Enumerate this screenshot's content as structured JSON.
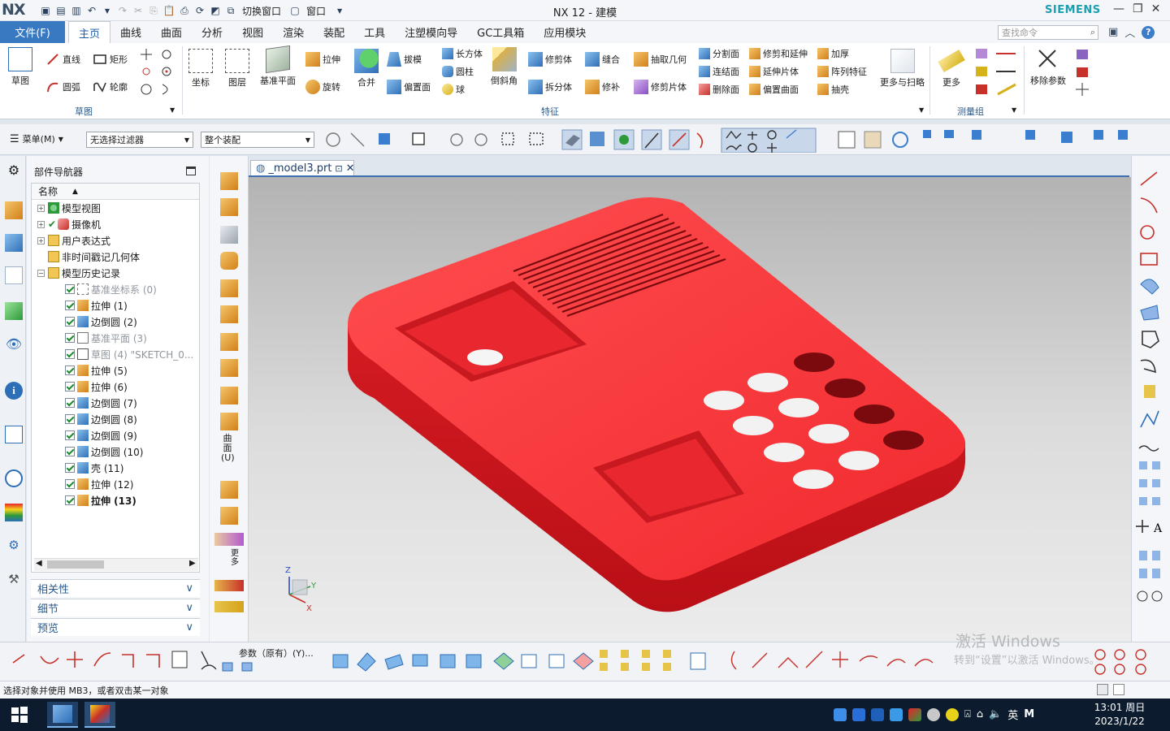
{
  "app": {
    "logo": "NX",
    "title": "NX 12 - 建模",
    "brand": "SIEMENS"
  },
  "qat": {
    "switch_window": "切换窗口",
    "window": "窗口"
  },
  "tabs": {
    "file": "文件(F)",
    "items": [
      "主页",
      "曲线",
      "曲面",
      "分析",
      "视图",
      "渲染",
      "装配",
      "工具",
      "注塑模向导",
      "GC工具箱",
      "应用模块"
    ]
  },
  "search": {
    "placeholder": "查找命令"
  },
  "ribbon": {
    "sketch": "草图",
    "line": "直线",
    "rect": "矩形",
    "arc": "圆弧",
    "profile": "轮廓",
    "coord": "坐标",
    "layer": "图层",
    "datum": "基准平面",
    "extrude": "拉伸",
    "revolve": "旋转",
    "unite": "合并",
    "draft": "拔模",
    "offset_face": "偏置面",
    "block": "长方体",
    "cylinder": "圆柱",
    "sphere": "球",
    "chamfer": "倒斜角",
    "trim_body": "修剪体",
    "split_body": "拆分体",
    "sew": "缝合",
    "patch": "修补",
    "extract_geom": "抽取几何",
    "trim_sheet": "修剪片体",
    "divide_face": "分割面",
    "connect_face": "连结面",
    "delete_face": "删除面",
    "trim_extend": "修剪和延伸",
    "extend_sheet": "延伸片体",
    "offset_surface": "偏置曲面",
    "thicken": "加厚",
    "pattern_feature": "阵列特征",
    "shell": "抽壳",
    "more_sweep": "更多与扫略",
    "more": "更多",
    "remove_params": "移除参数"
  },
  "groups": {
    "sketch": "草图",
    "feature": "特征",
    "measure": "测量组"
  },
  "toolbar2": {
    "menu": "菜单(M)",
    "filter": "无选择过滤器",
    "assembly": "整个装配"
  },
  "navigator": {
    "title": "部件导航器",
    "col_name": "名称",
    "nodes": [
      {
        "label": "模型视图"
      },
      {
        "label": "摄像机"
      },
      {
        "label": "用户表达式"
      },
      {
        "label": "非时间戳记几何体"
      },
      {
        "label": "模型历史记录"
      }
    ],
    "features": [
      "基准坐标系 (0)",
      "拉伸 (1)",
      "边倒圆 (2)",
      "基准平面 (3)",
      "草图 (4) \"SKETCH_0...",
      "拉伸 (5)",
      "拉伸 (6)",
      "边倒圆 (7)",
      "边倒圆 (8)",
      "边倒圆 (9)",
      "边倒圆 (10)",
      "壳 (11)",
      "拉伸 (12)",
      "拉伸 (13)"
    ],
    "accordions": [
      "相关性",
      "细节",
      "预览"
    ]
  },
  "vertical_label": "曲面(U)",
  "vertical_label2": "更多",
  "document": {
    "tab": "_model3.prt"
  },
  "triad": {
    "x": "X",
    "y": "Y",
    "z": "Z"
  },
  "bottom": {
    "params": "参数（原有）(Y)..."
  },
  "watermark": {
    "line1": "激活 Windows",
    "line2": "转到“设置”以激活 Windows。"
  },
  "status": "选择对象并使用 MB3，或者双击某一对象",
  "taskbar": {
    "ime": "英",
    "clock_time": "13:01 周日",
    "clock_date": "2023/1/22"
  },
  "colors": {
    "accent": "#3979c2",
    "model": "#e8232a",
    "brand": "#1c9fb0"
  }
}
